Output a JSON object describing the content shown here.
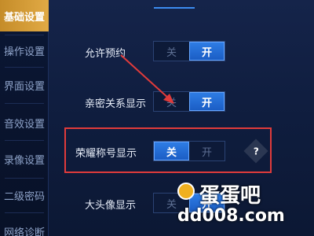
{
  "sidebar": {
    "items": [
      {
        "label": "基础设置",
        "active": true
      },
      {
        "label": "操作设置",
        "active": false
      },
      {
        "label": "界面设置",
        "active": false
      },
      {
        "label": "音效设置",
        "active": false
      },
      {
        "label": "录像设置",
        "active": false
      },
      {
        "label": "二级密码",
        "active": false
      },
      {
        "label": "网络诊断",
        "active": false
      }
    ]
  },
  "settings": [
    {
      "label": "允许预约",
      "off_label": "关",
      "on_label": "开",
      "value": "开"
    },
    {
      "label": "亲密关系显示",
      "off_label": "关",
      "on_label": "开",
      "value": "开"
    },
    {
      "label": "荣耀称号显示",
      "off_label": "关",
      "on_label": "开",
      "value": "关",
      "help": "?"
    },
    {
      "label": "大头像显示",
      "off_label": "关",
      "on_label": "开",
      "value": "开"
    }
  ],
  "watermark": {
    "title": "蛋蛋吧",
    "url": "dd008.com"
  },
  "colors": {
    "accent": "#2f7ee6",
    "sidebar_active": "#d39a35",
    "annotation": "#e03b3b"
  }
}
